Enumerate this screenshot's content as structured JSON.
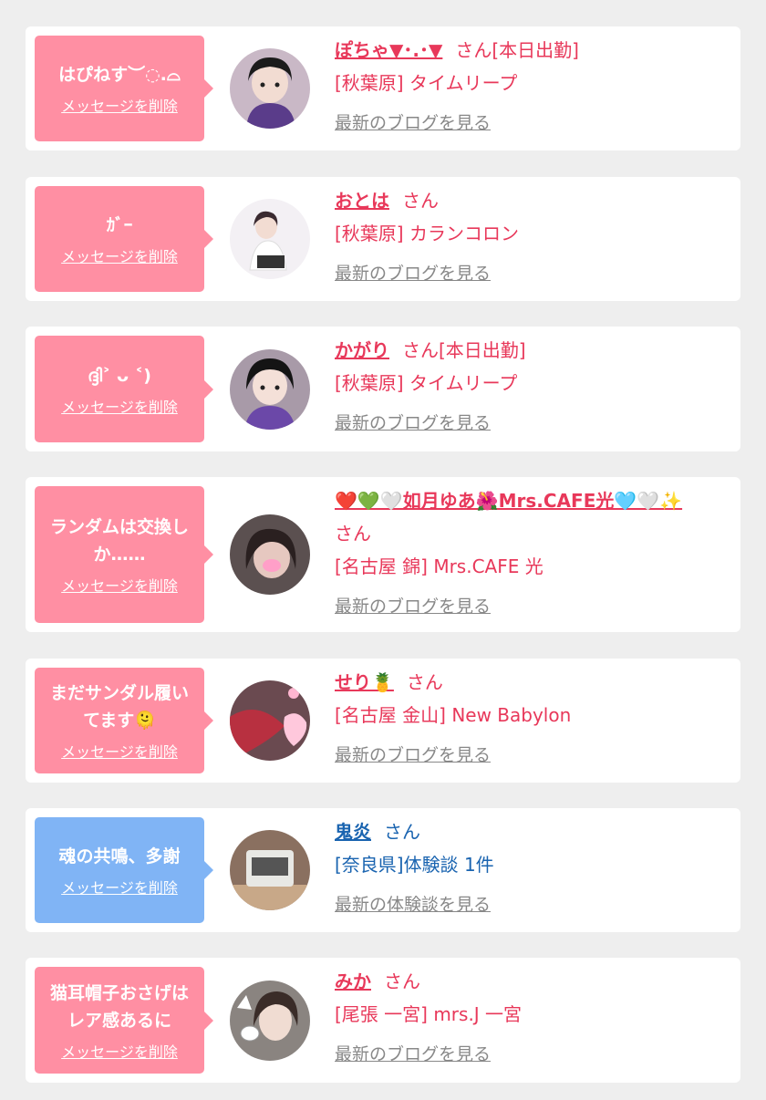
{
  "delete_label": "メッセージを削除",
  "colors": {
    "pink": "#ff8fa3",
    "blue": "#80b4f5",
    "name_pink": "#e8385a",
    "name_blue": "#1a64b0",
    "link_gray": "#888888"
  },
  "messages": [
    {
      "bubble_text": "はぴねす︶◌.⌓",
      "bubble_color": "pink",
      "name": "ぽちゃ▼･.･▼",
      "honorific": "さん[本日出勤]",
      "shop": "[秋葉原] タイムリープ",
      "link": "最新のブログを見る"
    },
    {
      "bubble_text": "ｶﾞｰ",
      "bubble_color": "pink",
      "name": "おとは",
      "honorific": "さん",
      "shop": "[秋葉原] カランコロン",
      "link": "最新のブログを見る"
    },
    {
      "bubble_text": "ദ്ദി˃ ᴗ ˂)",
      "bubble_color": "pink",
      "name": "かがり",
      "honorific": "さん[本日出勤]",
      "shop": "[秋葉原] タイムリープ",
      "link": "最新のブログを見る"
    },
    {
      "bubble_text": "ランダムは交換しか……",
      "bubble_color": "pink",
      "name": "❤️💚🤍如月ゆあ🌺Mrs.CAFE光🩵🤍✨",
      "honorific": "さん",
      "shop": "[名古屋 錦] Mrs.CAFE 光",
      "link": "最新のブログを見る"
    },
    {
      "bubble_text": "まだサンダル履いてます🫠",
      "bubble_color": "pink",
      "name": "せり🍍",
      "honorific": "さん",
      "shop": "[名古屋 金山] New Babylon",
      "link": "最新のブログを見る"
    },
    {
      "bubble_text": "魂の共鳴、多謝",
      "bubble_color": "blue",
      "name": "鬼炎",
      "honorific": "さん",
      "shop": "[奈良県]体験談 1件",
      "link": "最新の体験談を見る"
    },
    {
      "bubble_text": "猫耳帽子おさげはレア感あるに",
      "bubble_color": "pink",
      "name": "みか",
      "honorific": "さん",
      "shop": "[尾張 一宮] mrs.J 一宮",
      "link": "最新のブログを見る"
    }
  ]
}
